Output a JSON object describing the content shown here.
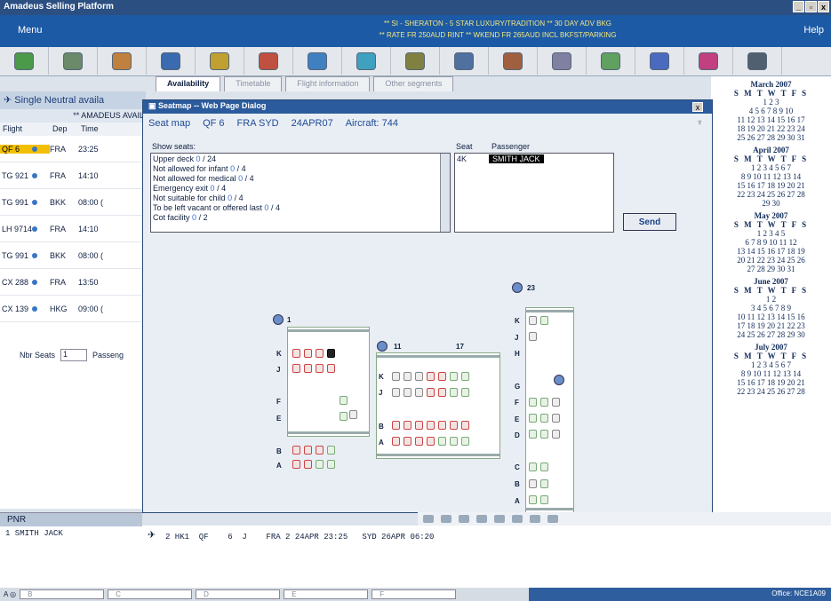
{
  "window": {
    "title": "Amadeus Selling Platform"
  },
  "menubar": {
    "menu_label": "Menu",
    "help_label": "Help",
    "notice_line1": "** SI - SHERATON - 5 STAR LUXURY/TRADITION ** 30 DAY ADV BKG",
    "notice_line2": "** RATE FR 250AUD RINT ** WKEND FR 265AUD INCL BKFST/PARKING"
  },
  "toolbar": {
    "icons": [
      "plant-icon",
      "book-icon",
      "money-icon",
      "plane-icon",
      "globe-icon",
      "person-icon",
      "car-icon",
      "beach-icon",
      "calculator-icon",
      "map-icon",
      "pax-icon",
      "drink-icon",
      "chart-icon",
      "info-icon",
      "heart-icon",
      "ship-icon"
    ]
  },
  "tabs": [
    {
      "label": "Availability"
    },
    {
      "label": "Timetable"
    },
    {
      "label": "Flight information"
    },
    {
      "label": "Other segments"
    }
  ],
  "left_panel": {
    "header": "Single Neutral availa",
    "subheader": "** AMADEUS AVAIL",
    "columns": [
      "Flight",
      "Dep",
      "Time"
    ],
    "rows": [
      {
        "flight": "QF 6",
        "dep": "FRA",
        "time": "23:25"
      },
      {
        "flight": "TG 921",
        "dep": "FRA",
        "time": "14:10"
      },
      {
        "flight": "TG 991",
        "dep": "BKK",
        "time": "08:00 ("
      },
      {
        "flight": "LH 9714",
        "dep": "FRA",
        "time": "14:10"
      },
      {
        "flight": "TG 991",
        "dep": "BKK",
        "time": "08:00 ("
      },
      {
        "flight": "CX 288",
        "dep": "FRA",
        "time": "13:50"
      },
      {
        "flight": "CX 139",
        "dep": "HKG",
        "time": "09:00 ("
      }
    ],
    "nbr_label": "Nbr Seats",
    "nbr_value": "1",
    "passenger_label": "Passeng"
  },
  "dialog": {
    "title": "Seatmap -- Web Page Dialog",
    "close": "x",
    "header": {
      "label": "Seat map",
      "flight": "QF 6",
      "route": "FRA SYD",
      "date": "24APR07",
      "aircraft": "Aircraft: 744"
    },
    "show_seats_label": "Show seats:",
    "show_seats": [
      {
        "label": "Upper deck",
        "count": "0",
        "total": "/ 24"
      },
      {
        "label": "Not allowed for infant",
        "count": "0",
        "total": "/ 4"
      },
      {
        "label": "Not allowed for medical",
        "count": "0",
        "total": "/ 4"
      },
      {
        "label": "Emergency exit",
        "count": "0",
        "total": "/ 4"
      },
      {
        "label": "Not suitable for child",
        "count": "0",
        "total": "/ 4"
      },
      {
        "label": "To be left vacant or offered last",
        "count": "0",
        "total": "/ 4"
      },
      {
        "label": "Cot facility",
        "count": "0",
        "total": "/ 2"
      }
    ],
    "seat_col": "Seat",
    "passenger_col": "Passenger",
    "assignment": {
      "seat": "4K",
      "passenger": "SMITH JACK"
    },
    "send_label": "Send",
    "seatmap": {
      "col_numbers": [
        "1",
        "11",
        "17",
        "23"
      ],
      "row_letters": [
        "K",
        "J",
        "F",
        "E",
        "B",
        "A",
        "H",
        "G",
        "D",
        "C"
      ]
    }
  },
  "calendar": {
    "months": [
      {
        "title": "March 2007",
        "rows": [
          "1 2 3",
          "4 5 6 7 8 9 10",
          "11 12 13 14 15 16 17",
          "18 19 20 21 22 23 24",
          "25 26 27 28 29 30 31"
        ]
      },
      {
        "title": "April 2007",
        "rows": [
          "1 2 3 4 5 6 7",
          "8 9 10 11 12 13 14",
          "15 16 17 18 19 20 21",
          "22 23 24 25 26 27 28",
          "29 30"
        ]
      },
      {
        "title": "May 2007",
        "rows": [
          "1 2 3 4 5",
          "6 7 8 9 10 11 12",
          "13 14 15 16 17 18 19",
          "20 21 22 23 24 25 26",
          "27 28 29 30 31"
        ]
      },
      {
        "title": "June 2007",
        "rows": [
          "1 2",
          "3 4 5 6 7 8 9",
          "10 11 12 13 14 15 16",
          "17 18 19 20 21 22 23",
          "24 25 26 27 28 29 30"
        ]
      },
      {
        "title": "July 2007",
        "rows": [
          "1 2 3 4 5 6 7",
          "8 9 10 11 12 13 14",
          "15 16 17 18 19 20 21",
          "22 23 24 25 26 27 28"
        ]
      }
    ],
    "weekdays": "S M T W T F S"
  },
  "pnr": {
    "title": "PNR",
    "line": "1 SMITH JACK"
  },
  "segment": {
    "line": "2 HK1  QF    6  J    FRA 2 24APR 23:25   SYD 26APR 06:20"
  },
  "statusbar": {
    "fields": [
      "B",
      "C",
      "D",
      "E",
      "F"
    ],
    "office": "Office: NCE1A09"
  }
}
